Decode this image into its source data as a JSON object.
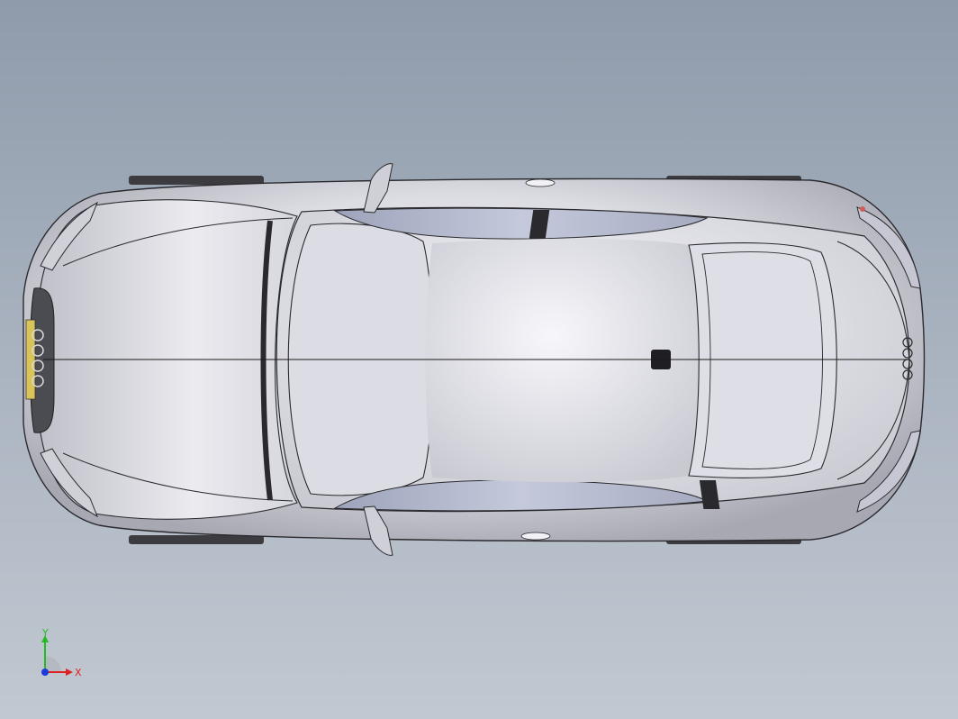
{
  "viewport": {
    "model_name": "car-top-view"
  },
  "triad": {
    "x_label": "X",
    "y_label": "Y",
    "x_color": "#e02020",
    "y_color": "#22bb22",
    "z_color": "#1a3adb"
  },
  "colors": {
    "background_top": "#8f9bab",
    "background_bottom": "#c1c8d1",
    "body": "#e6e5ea",
    "edge": "#2a2a2e",
    "glass": "#b9bfd3"
  }
}
